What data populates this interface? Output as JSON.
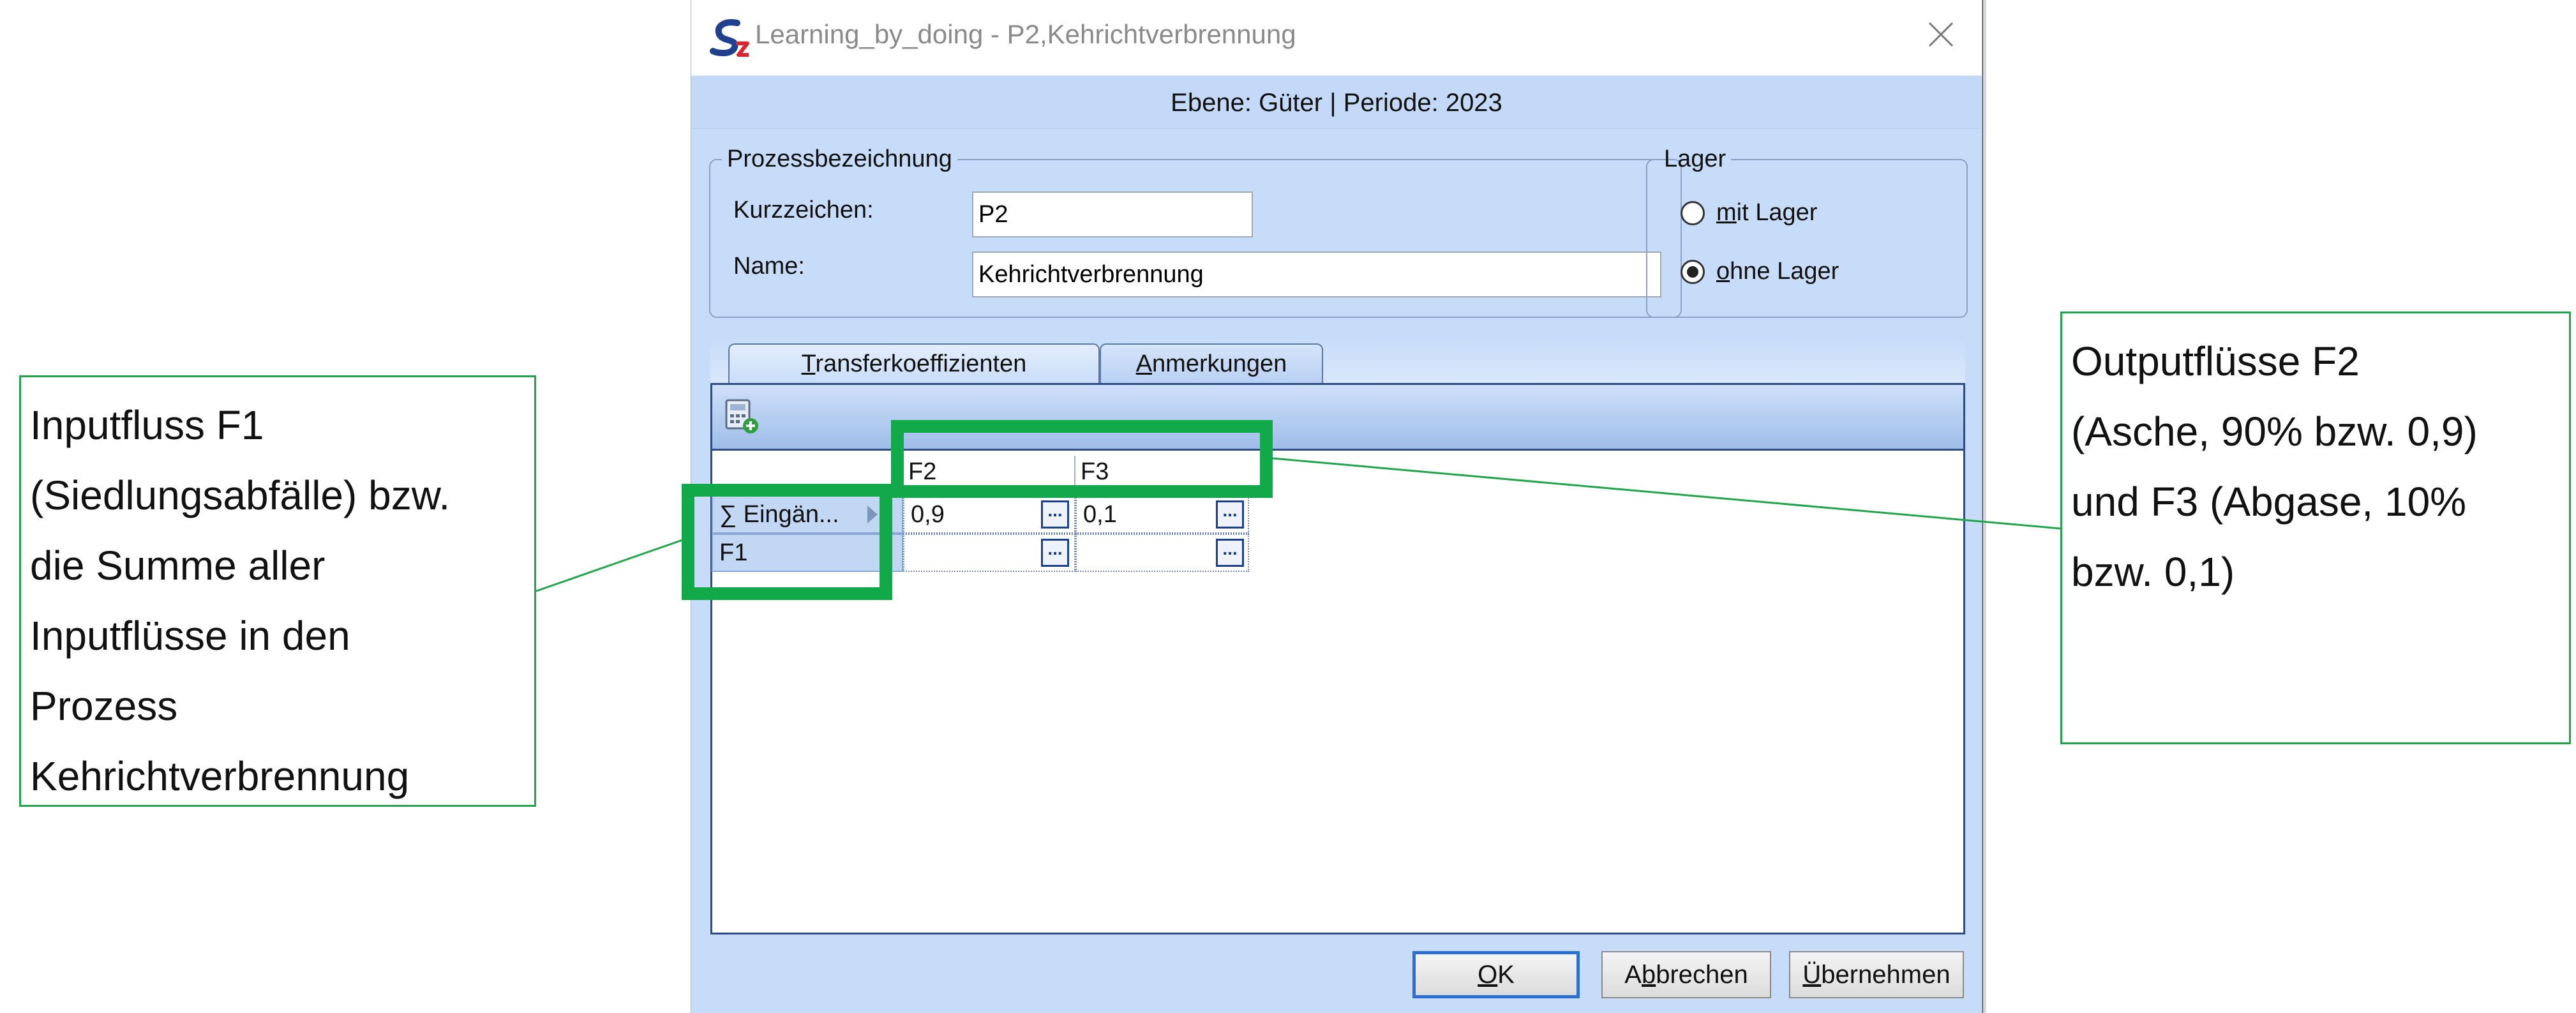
{
  "window": {
    "title": "Learning_by_doing - P2,Kehrichtverbrennung",
    "level_text": "Ebene: Güter | Periode: 2023"
  },
  "process": {
    "legend": "Prozessbezeichnung",
    "short_label": "Kurzzeichen:",
    "short_value": "P2",
    "name_label": "Name:",
    "name_value": "Kehrichtverbrennung"
  },
  "storage": {
    "legend": "Lager",
    "option_with_mnemonic": "m",
    "option_with_rest": "it Lager",
    "option_without_mnemonic": "o",
    "option_without_rest": "hne Lager",
    "selected": "ohne Lager"
  },
  "tabs": [
    {
      "mnemonic": "T",
      "rest": "ransferkoeffizienten",
      "active": true
    },
    {
      "mnemonic": "A",
      "rest": "nmerkungen",
      "active": false
    }
  ],
  "grid": {
    "columns": [
      "F2",
      "F3"
    ],
    "rows": [
      {
        "header": "∑ Eingän...",
        "values": [
          "0,9",
          "0,1"
        ]
      },
      {
        "header": "F1",
        "values": [
          "",
          ""
        ]
      }
    ],
    "ellipsis": "..."
  },
  "buttons": {
    "ok_mnemonic": "O",
    "ok_rest": "K",
    "cancel_pre": "A",
    "cancel_mnemonic": "b",
    "cancel_rest": "brechen",
    "apply_mnemonic": "Ü",
    "apply_rest": "bernehmen"
  },
  "annotations": {
    "input_lines": [
      "Inputfluss F1",
      "(Siedlungsabfälle) bzw.",
      "die Summe aller",
      "Inputflüsse in den",
      "Prozess",
      "Kehrichtverbrennung"
    ],
    "output_lines": [
      "Outputflüsse F2",
      "(Asche, 90% bzw. 0,9)",
      "und F3 (Abgase, 10%",
      "bzw. 0,1)"
    ],
    "color": "#1fa64a"
  },
  "colors": {
    "dialog_bg": "#c6dcf8",
    "panel_border": "#2e4a87",
    "highlight": "#12a94a"
  }
}
